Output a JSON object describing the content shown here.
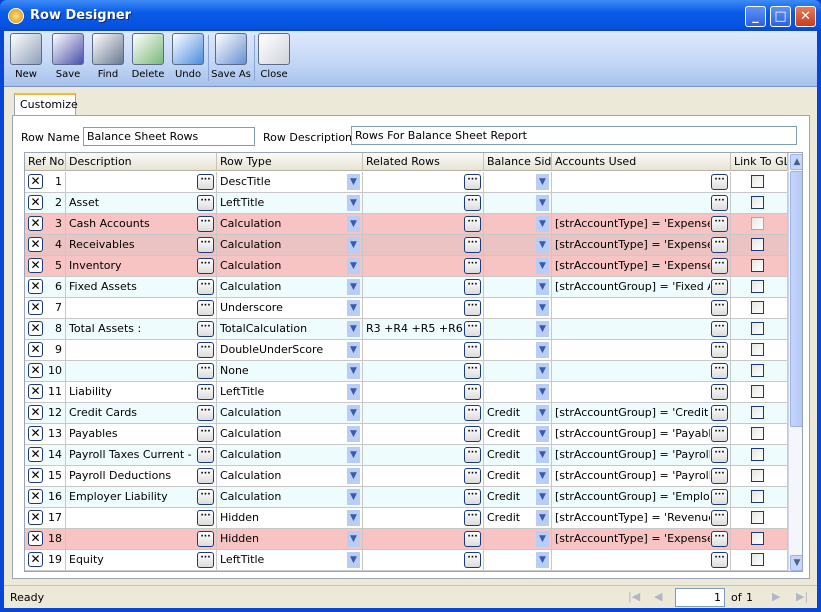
{
  "window": {
    "title": "Row Designer",
    "minimize": "_",
    "maximize": "□",
    "close": "✕"
  },
  "toolbar": [
    {
      "label": "New",
      "icon": "new-row-icon"
    },
    {
      "label": "Save",
      "icon": "floppy-disk-icon"
    },
    {
      "label": "Find",
      "icon": "binoculars-icon"
    },
    {
      "label": "Delete",
      "icon": "recycle-bin-icon"
    },
    {
      "label": "Undo",
      "icon": "undo-arrow-icon"
    },
    {
      "label": "Save As",
      "icon": "save-as-icon"
    },
    {
      "label": "Close",
      "icon": "close-window-icon"
    }
  ],
  "tabs": [
    {
      "label": "Customize",
      "active": true
    }
  ],
  "form": {
    "row_name_label": "Row Name",
    "row_name": "Balance Sheet Rows",
    "row_desc_label": "Row Description",
    "row_desc": "Rows For Balance Sheet Report"
  },
  "grid": {
    "columns": [
      "Ref No.",
      "Description",
      "Row Type",
      "Related Rows",
      "Balance Side",
      "Accounts Used",
      "Link To GL"
    ],
    "rows": [
      {
        "ref": "1",
        "desc": "",
        "type": "DescTitle",
        "related": "",
        "side": "",
        "accounts": "",
        "link": false,
        "hl": ""
      },
      {
        "ref": "2",
        "desc": "Asset",
        "type": "LeftTitle",
        "related": "",
        "side": "",
        "accounts": "",
        "link": false,
        "hl": ""
      },
      {
        "ref": "3",
        "desc": "Cash Accounts",
        "type": "Calculation",
        "related": "",
        "side": "",
        "accounts": "[strAccountType] = 'Expense'",
        "link": false,
        "hl": "pink"
      },
      {
        "ref": "4",
        "desc": "Receivables",
        "type": "Calculation",
        "related": "",
        "side": "",
        "accounts": "[strAccountType] = 'Expense'",
        "link": false,
        "hl": "pink2"
      },
      {
        "ref": "5",
        "desc": "Inventory",
        "type": "Calculation",
        "related": "",
        "side": "",
        "accounts": "[strAccountType] = 'Expense'",
        "link": false,
        "hl": "pink"
      },
      {
        "ref": "6",
        "desc": "Fixed Assets",
        "type": "Calculation",
        "related": "",
        "side": "",
        "accounts": "[strAccountGroup] = 'Fixed Asse",
        "link": false,
        "hl": ""
      },
      {
        "ref": "7",
        "desc": "",
        "type": "Underscore",
        "related": "",
        "side": "",
        "accounts": "",
        "link": false,
        "hl": ""
      },
      {
        "ref": "8",
        "desc": "Total Assets :",
        "type": "TotalCalculation",
        "related": "R3 +R4 +R5 +R6",
        "side": "",
        "accounts": "",
        "link": false,
        "hl": ""
      },
      {
        "ref": "9",
        "desc": "",
        "type": "DoubleUnderScore",
        "related": "",
        "side": "",
        "accounts": "",
        "link": false,
        "hl": ""
      },
      {
        "ref": "10",
        "desc": "",
        "type": "None",
        "related": "",
        "side": "",
        "accounts": "",
        "link": false,
        "hl": ""
      },
      {
        "ref": "11",
        "desc": "Liability",
        "type": "LeftTitle",
        "related": "",
        "side": "",
        "accounts": "",
        "link": false,
        "hl": ""
      },
      {
        "ref": "12",
        "desc": "Credit Cards",
        "type": "Calculation",
        "related": "",
        "side": "Credit",
        "accounts": "[strAccountGroup] = 'Credit Car",
        "link": false,
        "hl": ""
      },
      {
        "ref": "13",
        "desc": "Payables",
        "type": "Calculation",
        "related": "",
        "side": "Credit",
        "accounts": "[strAccountGroup] = 'Payables'",
        "link": false,
        "hl": ""
      },
      {
        "ref": "14",
        "desc": "Payroll Taxes Current - Pa",
        "type": "Calculation",
        "related": "",
        "side": "Credit",
        "accounts": "[strAccountGroup] = 'Payroll Ta:",
        "link": false,
        "hl": ""
      },
      {
        "ref": "15",
        "desc": "Payroll Deductions",
        "type": "Calculation",
        "related": "",
        "side": "Credit",
        "accounts": "[strAccountGroup] = 'Payroll De",
        "link": false,
        "hl": ""
      },
      {
        "ref": "16",
        "desc": "Employer Liability",
        "type": "Calculation",
        "related": "",
        "side": "Credit",
        "accounts": "[strAccountGroup] = 'Employer L",
        "link": false,
        "hl": ""
      },
      {
        "ref": "17",
        "desc": "",
        "type": "Hidden",
        "related": "",
        "side": "Credit",
        "accounts": "[strAccountType] = 'Revenue'",
        "link": false,
        "hl": ""
      },
      {
        "ref": "18",
        "desc": "",
        "type": "Hidden",
        "related": "",
        "side": "",
        "accounts": "[strAccountType] = 'Expense'",
        "link": false,
        "hl": "pink"
      },
      {
        "ref": "19",
        "desc": "Equity",
        "type": "LeftTitle",
        "related": "",
        "side": "",
        "accounts": "",
        "link": false,
        "hl": ""
      }
    ]
  },
  "status": {
    "text": "Ready",
    "page": "1",
    "of_label": "of",
    "total": "1"
  },
  "colors": {
    "pink": "#f7c3c3",
    "pink2": "#ecc3c3",
    "alt": "#effcfd",
    "titlebar": "#0a5ae8"
  }
}
